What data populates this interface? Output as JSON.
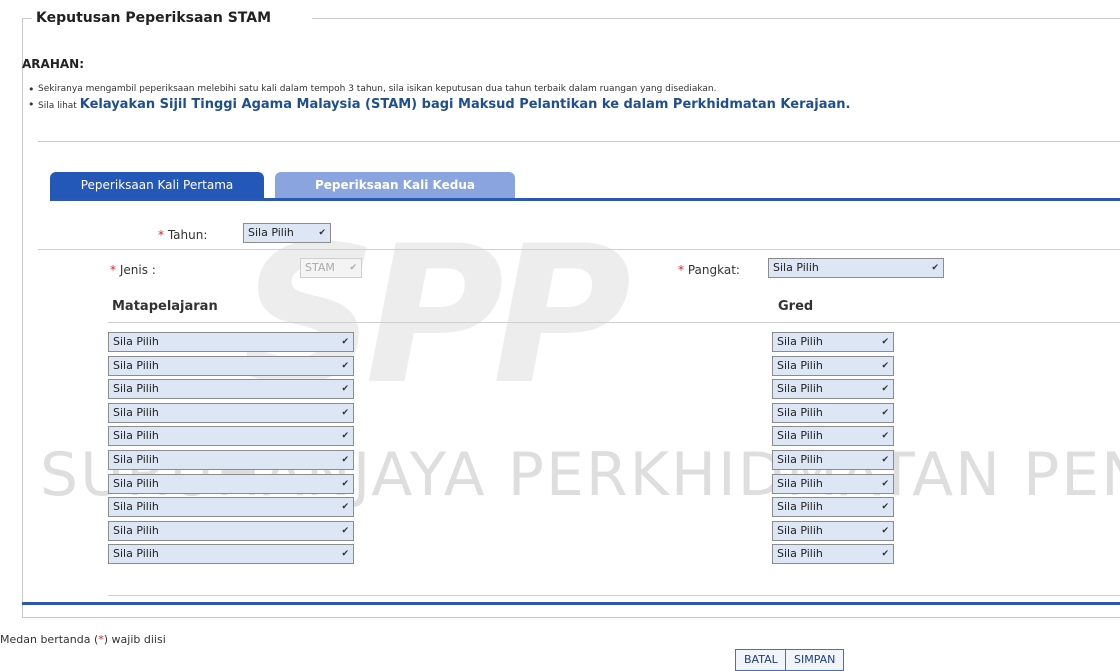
{
  "section": {
    "legend": "Keputusan Peperiksaan STAM",
    "instructions_title": "ARAHAN:",
    "instruction_1": "Sekiranya mengambil peperiksaan melebihi satu kali dalam tempoh 3 tahun, sila isikan keputusan dua tahun terbaik dalam ruangan yang disediakan.",
    "instruction_2_prefix": "Sila lihat",
    "instruction_2_link": "Kelayakan Sijil Tinggi Agama Malaysia (STAM) bagi Maksud Pelantikan ke dalam Perkhidmatan Kerajaan."
  },
  "tabs": [
    {
      "label": "Peperiksaan Kali Pertama",
      "active": true
    },
    {
      "label": "Peperiksaan Kali Kedua",
      "active": false
    }
  ],
  "form": {
    "tahun_label": "Tahun:",
    "tahun_value": "Sila Pilih",
    "jenis_label": "Jenis :",
    "jenis_value": "STAM",
    "pangkat_label": "Pangkat:",
    "pangkat_value": "Sila Pilih",
    "required_mark": "*",
    "col_subject": "Matapelajaran",
    "col_grade": "Gred",
    "subject_rows": [
      "Sila Pilih",
      "Sila Pilih",
      "Sila Pilih",
      "Sila Pilih",
      "Sila Pilih",
      "Sila Pilih",
      "Sila Pilih",
      "Sila Pilih",
      "Sila Pilih",
      "Sila Pilih"
    ],
    "grade_rows": [
      "Sila Pilih",
      "Sila Pilih",
      "Sila Pilih",
      "Sila Pilih",
      "Sila Pilih",
      "Sila Pilih",
      "Sila Pilih",
      "Sila Pilih",
      "Sila Pilih",
      "Sila Pilih"
    ]
  },
  "watermark": {
    "text": "SURUHANJAYA PERKHIDMATAN PENDIDIKAN",
    "logo": "SPP"
  },
  "footer": {
    "note_prefix": "Medan bertanda (",
    "note_mark": "*",
    "note_suffix": ") wajib diisi",
    "cancel_label": "BATAL",
    "save_label": "SIMPAN"
  }
}
